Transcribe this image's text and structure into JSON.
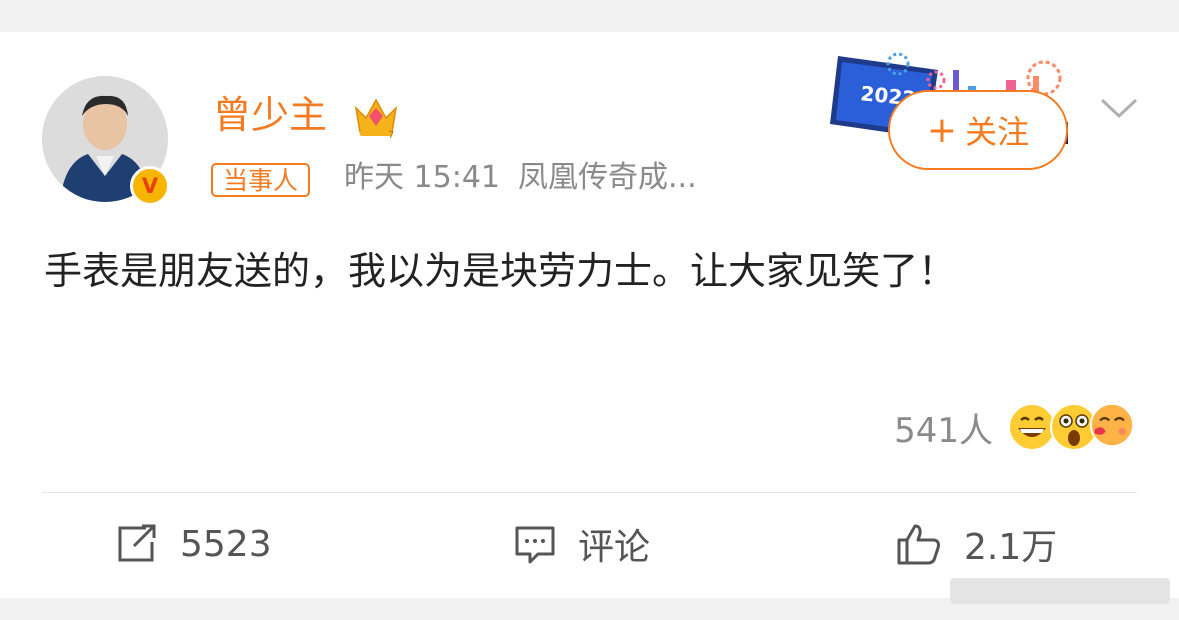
{
  "post": {
    "username": "曾少主",
    "role_badge": "当事人",
    "time": "昨天 15:41",
    "source": "凤凰传奇成...",
    "follow_label": "关注",
    "follow_plus": "+",
    "banner_year": "2022",
    "content": "手表是朋友送的，我以为是块劳力士。让大家见笑了！",
    "likes_people": "541人",
    "reactions": [
      "grinning-emoji",
      "surprised-emoji",
      "kiss-emoji"
    ]
  },
  "actions": {
    "repost_count": "5523",
    "comment_label": "评论",
    "like_count": "2.1万"
  },
  "colors": {
    "accent": "#f47b20",
    "muted": "#8a8a8a",
    "text": "#222222"
  }
}
